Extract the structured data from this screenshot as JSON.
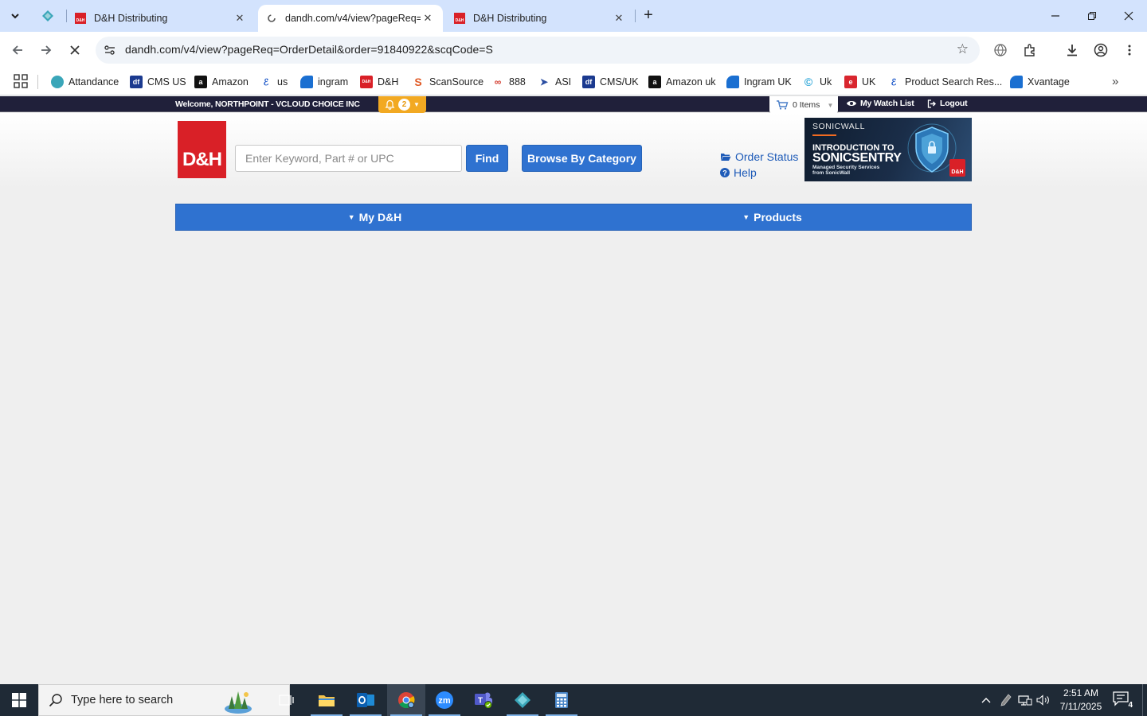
{
  "browser": {
    "tabs": [
      {
        "title": "D&H Distributing",
        "active": false
      },
      {
        "title": "dandh.com/v4/view?pageReq=",
        "active": true
      },
      {
        "title": "D&H Distributing",
        "active": false
      }
    ],
    "url": "dandh.com/v4/view?pageReq=OrderDetail&order=91840922&scqCode=S",
    "bookmarks": [
      {
        "label": "Attandance",
        "icon": "teal-diamond-icon",
        "color": "#3aa6b9"
      },
      {
        "label": "CMS US",
        "icon": "df-icon",
        "color": "#1b3a8f"
      },
      {
        "label": "Amazon",
        "icon": "amazon-icon",
        "color": "#111111"
      },
      {
        "label": "us",
        "icon": "ec-icon",
        "color": "#1a56c8"
      },
      {
        "label": "ingram",
        "icon": "ingram-icon",
        "color": "#1a6fd1"
      },
      {
        "label": "D&H",
        "icon": "dh-icon",
        "color": "#d92027"
      },
      {
        "label": "ScanSource",
        "icon": "scansource-icon",
        "color": "#e05a26"
      },
      {
        "label": "888",
        "icon": "888-icon",
        "color": "#d23a2c"
      },
      {
        "label": "ASI",
        "icon": "asi-icon",
        "color": "#2b4ea2"
      },
      {
        "label": "CMS/UK",
        "icon": "df-icon",
        "color": "#1b3a8f"
      },
      {
        "label": "Amazon uk",
        "icon": "amazon-icon",
        "color": "#111111"
      },
      {
        "label": "Ingram UK",
        "icon": "ingram-icon",
        "color": "#1a6fd1"
      },
      {
        "label": "Uk",
        "icon": "c-icon",
        "color": "#2aa5d8"
      },
      {
        "label": "UK",
        "icon": "e-icon",
        "color": "#d9262f"
      },
      {
        "label": "Product Search Res...",
        "icon": "ec-icon",
        "color": "#1a56c8"
      },
      {
        "label": "Xvantage",
        "icon": "ingram-icon",
        "color": "#1a6fd1"
      }
    ]
  },
  "page": {
    "welcome": "Welcome, NORTHPOINT - VCLOUD CHOICE INC",
    "notifications": "2",
    "cart": "0 Items",
    "watch_list": "My Watch List",
    "logout": "Logout",
    "logo": "D&H",
    "search_placeholder": "Enter Keyword, Part # or UPC",
    "find": "Find",
    "browse": "Browse By Category",
    "order_status": "Order Status",
    "help": "Help",
    "banner": {
      "brand": "SONICWALL",
      "line1": "INTRODUCTION TO",
      "line2": "SONICSENTRY",
      "sub1": "Managed Security Services",
      "sub2": "from SonicWall",
      "mark": "D&H"
    },
    "nav": [
      {
        "label": "My D&H"
      },
      {
        "label": "Products"
      }
    ]
  },
  "taskbar": {
    "search_placeholder": "Type here to search",
    "time": "2:51 AM",
    "date": "7/11/2025",
    "notifications": "4"
  },
  "colors": {
    "accent_blue": "#2f72d0",
    "brand_red": "#d92027",
    "topbar": "#20203a",
    "notif_orange": "#f2a922"
  }
}
